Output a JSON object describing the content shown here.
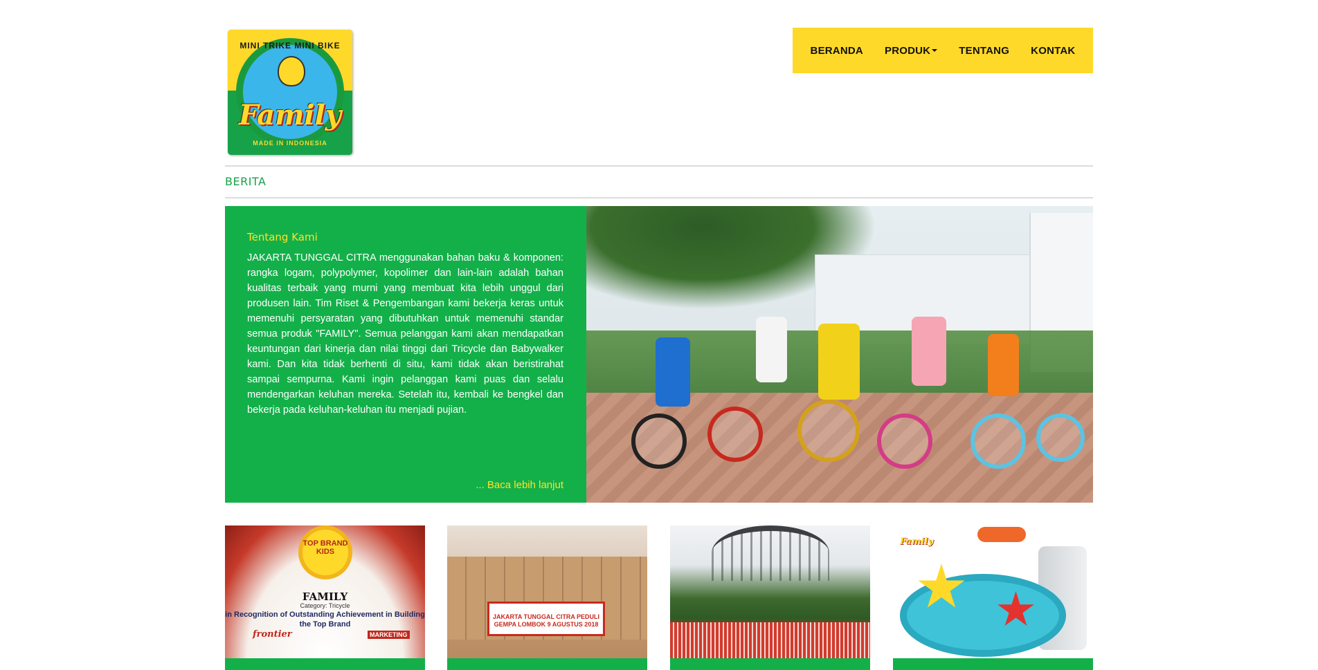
{
  "brand": {
    "arc_text": "MINI TRIKE MINI BIKE",
    "name": "Family",
    "tagline": "MADE IN INDONESIA"
  },
  "nav": {
    "items": [
      {
        "label": "BERANDA"
      },
      {
        "label": "PRODUK"
      },
      {
        "label": "TENTANG"
      },
      {
        "label": "KONTAK"
      }
    ]
  },
  "section": {
    "title": "BERITA"
  },
  "about": {
    "title": "Tentang Kami",
    "body": "JAKARTA TUNGGAL CITRA menggunakan bahan baku & komponen: rangka logam, polypolymer, kopolimer dan lain-lain adalah bahan kualitas terbaik yang  murni yang membuat kita lebih unggul dari produsen lain. Tim Riset & Pengembangan kami bekerja keras untuk memenuhi persyaratan yang dibutuhkan untuk memenuhi standar semua produk \"FAMILY\". Semua pelanggan kami akan mendapatkan keuntungan dari kinerja dan nilai tinggi dari Tricycle dan Babywalker kami. Dan kita tidak berhenti di situ, kami tidak akan beristirahat sampai sempurna. Kami ingin pelanggan kami puas dan selalu mendengarkan keluhan mereka. Setelah itu, kembali ke bengkel dan bekerja pada keluhan-keluhan itu menjadi pujian.",
    "more_label": "... Baca lebih lanjut"
  },
  "thumbnails": {
    "award": {
      "badge": "TOP BRAND KIDS",
      "brand": "FAMILY",
      "category": "Category: Tricycle",
      "recognition": "in Recognition of Outstanding Achievement in Building the Top Brand",
      "sponsor1": "frontier",
      "sponsor2": "MARKETING"
    },
    "charity": {
      "banner": "JAKARTA TUNGGAL CITRA PEDULI GEMPA LOMBOK 9 AGUSTUS 2018"
    },
    "event": {},
    "product": {
      "logo_text": "Family"
    }
  },
  "colors": {
    "brand_yellow": "#ffd92a",
    "brand_green": "#13b04a",
    "title_green": "#17a24a",
    "link_yellow": "#ffe22b"
  }
}
